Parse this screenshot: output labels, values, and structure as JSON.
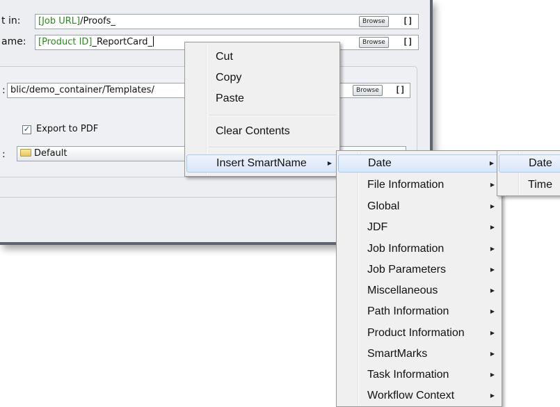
{
  "dialog": {
    "folder_label": "t in:",
    "folder_token": "[Job URL]",
    "folder_rest": "/Proofs_",
    "name_label": "ame:",
    "name_token": "[Product ID]",
    "name_rest": "_ReportCard_",
    "template_label": ":",
    "template_value": "blic/demo_container/Templates/",
    "export_pdf_label": "Export to PDF",
    "export_pdf_checked": "✓",
    "preset_label": ":",
    "preset_value": "Default",
    "browse_label": "Browse",
    "bracket_label": "[]"
  },
  "context_menu": {
    "items": [
      "Cut",
      "Copy",
      "Paste",
      "Clear Contents",
      "Insert SmartName"
    ]
  },
  "smartname_menu": {
    "items": [
      "Date",
      "File Information",
      "Global",
      "JDF",
      "Job Information",
      "Job Parameters",
      "Miscellaneous",
      "Path Information",
      "Product Information",
      "SmartMarks",
      "Task Information",
      "Workflow Context"
    ]
  },
  "date_menu": {
    "items": [
      "Date",
      "Time"
    ]
  },
  "icons": {
    "submenu_arrow": "▶",
    "folder": "folder-icon"
  }
}
